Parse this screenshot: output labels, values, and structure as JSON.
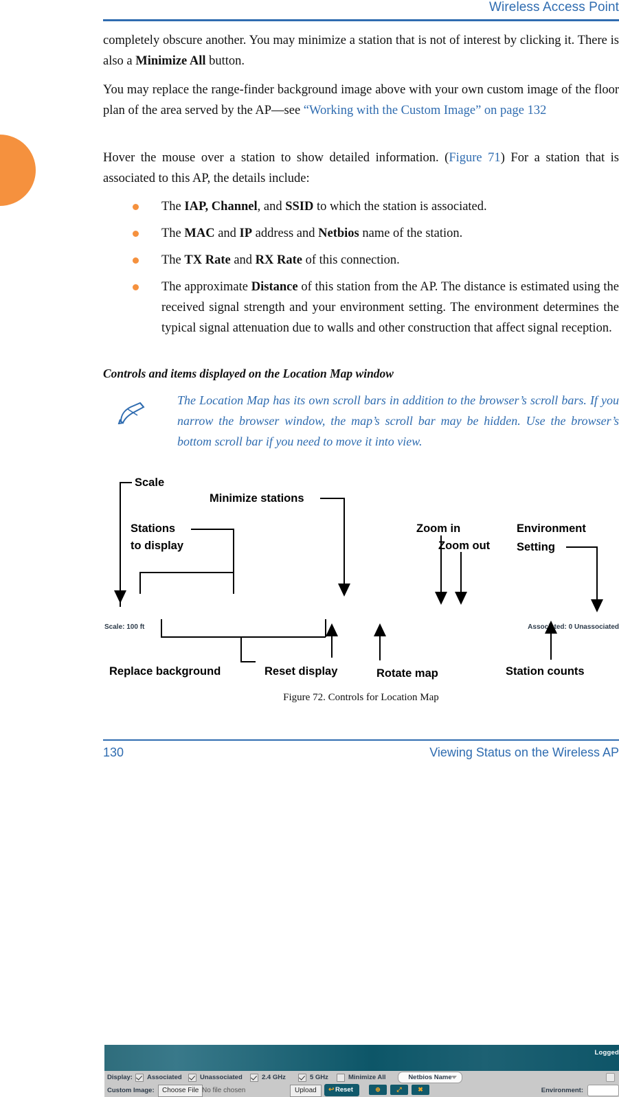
{
  "header": {
    "title": "Wireless Access Point"
  },
  "footer": {
    "page_number": "130",
    "section": "Viewing Status on the Wireless AP"
  },
  "paragraphs": {
    "p1_a": "completely obscure another. You may minimize a station that is not of interest by clicking it. There is also a ",
    "p1_b": "Minimize All",
    "p1_c": " button.",
    "p2_a": "You may replace the range-finder background image above with your own custom image of the floor plan of the area served by the AP—see ",
    "p2_link": "“Working with the Custom Image” on page 132",
    "p3_a": "Hover the mouse over a station to show detailed information. (",
    "p3_link": "Figure 71",
    "p3_b": ") For a station that is associated to this AP, the details include:"
  },
  "bullets": [
    {
      "pre": "The ",
      "b1": "IAP, Channel",
      "mid1": ", and ",
      "b2": "SSID",
      "post": " to which the station is associated."
    },
    {
      "pre": "The ",
      "b1": "MAC",
      "mid1": " and ",
      "b2": "IP",
      "post": " address and ",
      "b3": "Netbios",
      "post2": " name of the station."
    },
    {
      "pre": "The ",
      "b1": "TX Rate",
      "mid1": " and ",
      "b2": "RX Rate",
      "post": " of this connection."
    },
    {
      "pre": "The approximate ",
      "b1": "Distance",
      "post": " of this station from the AP. The distance is estimated using the received signal strength and your environment setting. The environment determines the typical signal attenuation due to walls and other construction that affect signal reception."
    }
  ],
  "subheading": "Controls and items displayed on the Location Map window",
  "note": {
    "icon": "pencil-note-icon",
    "text": "The Location Map has its own scroll bars in addition to the browser’s scroll bars. If you narrow the browser window, the map’s scroll bar may be hidden. Use the browser’s bottom scroll bar if you need to move it into view."
  },
  "figure": {
    "caption": "Figure 72. Controls for Location Map",
    "callouts": {
      "scale": "Scale",
      "stations_to_display_l1": "Stations",
      "stations_to_display_l2": "to display",
      "minimize_stations": "Minimize stations",
      "zoom_in": "Zoom in",
      "zoom_out": "Zoom out",
      "environment_l1": "Environment",
      "environment_l2": "Setting",
      "replace_background": "Replace background",
      "reset_display": "Reset display",
      "rotate_map": "Rotate map",
      "station_counts": "Station counts"
    },
    "screenshot": {
      "logged_label": "Logged",
      "display_label": "Display:",
      "checkboxes": [
        {
          "label": "Associated",
          "checked": true
        },
        {
          "label": "Unassociated",
          "checked": true
        },
        {
          "label": "2.4 GHz",
          "checked": true
        },
        {
          "label": "5 GHz",
          "checked": true
        },
        {
          "label": "Minimize All",
          "checked": false
        }
      ],
      "name_dropdown": {
        "value": "Netbios Name",
        "icon": "chevron-down-icon"
      },
      "custom_image_label": "Custom Image:",
      "choose_file_label": "Choose File",
      "no_file_label": "No file chosen",
      "upload_label": "Upload",
      "reset_label": "Reset",
      "reset_icon": "undo-arrow-icon",
      "map_buttons": [
        {
          "name": "zoom-in-button",
          "glyph": "⊕"
        },
        {
          "name": "rotate-map-button",
          "glyph": "⤢"
        },
        {
          "name": "zoom-out-button",
          "glyph": "✖"
        }
      ],
      "environment_label": "Environment:",
      "environment_value": "",
      "scale_text": "Scale: 100 ft",
      "counts_text": "Associated: 0   Unassociated"
    }
  },
  "colors": {
    "accent_blue": "#2f6cb0",
    "accent_orange": "#f5913e",
    "app_teal": "#0d5668",
    "app_panel_gray": "#c9c9c9"
  }
}
